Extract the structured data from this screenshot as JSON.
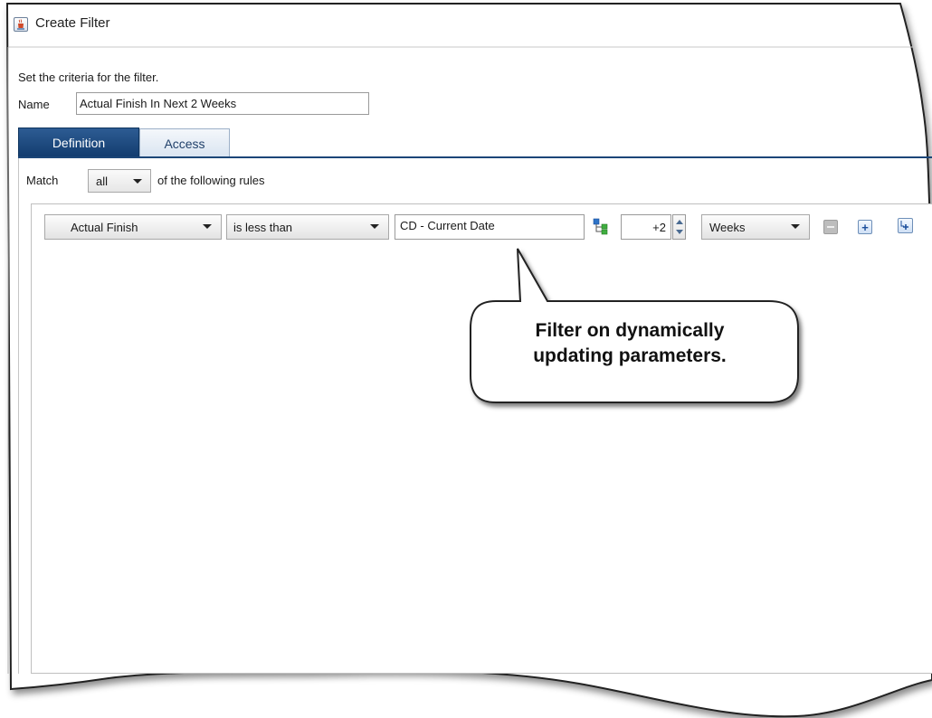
{
  "window": {
    "title": "Create Filter",
    "icon": "java-cup-icon"
  },
  "form": {
    "instructions": "Set the criteria for the filter.",
    "name_label": "Name",
    "name_value": "Actual Finish In Next 2 Weeks"
  },
  "tabs": [
    {
      "label": "Definition",
      "selected": true
    },
    {
      "label": "Access",
      "selected": false
    }
  ],
  "match": {
    "prefix": "Match",
    "selected": "all",
    "suffix": "of the following rules"
  },
  "rule": {
    "field": "Actual Finish",
    "operator": "is less than",
    "value": "CD - Current Date",
    "offset": "+2",
    "unit": "Weeks"
  },
  "callout": {
    "line1": "Filter on dynamically",
    "line2": "updating parameters."
  },
  "colors": {
    "tab_selected": "#1c4678",
    "tab_unselected": "#dfe8f3",
    "accent_rule": "#1c4678"
  }
}
